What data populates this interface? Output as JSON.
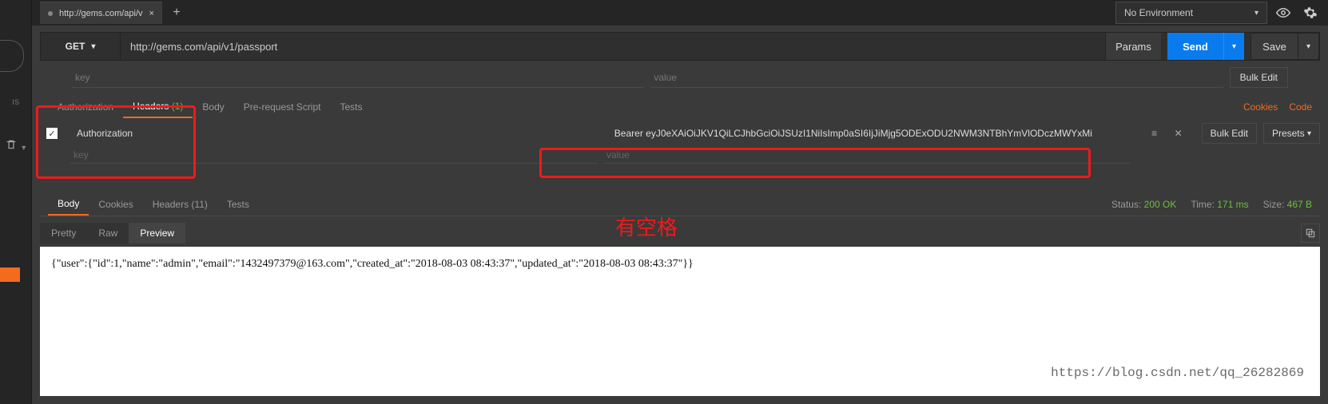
{
  "sidebar": {
    "label": "ıs",
    "trash_icon": "trash-icon"
  },
  "tab": {
    "title": "http://gems.com/api/v",
    "close": "×"
  },
  "env": {
    "selected": "No Environment",
    "eye": "eye-icon",
    "gear": "gear-icon"
  },
  "request": {
    "method": "GET",
    "url": "http://gems.com/api/v1/passport",
    "params_label": "Params",
    "send_label": "Send",
    "save_label": "Save"
  },
  "kv": {
    "key_placeholder": "key",
    "value_placeholder": "value",
    "bulk_edit": "Bulk Edit"
  },
  "tabs_req": {
    "authorization": "Authorization",
    "headers": "Headers",
    "headers_count": "(1)",
    "body": "Body",
    "prerequest": "Pre-request Script",
    "tests": "Tests",
    "cookies": "Cookies",
    "code": "Code"
  },
  "headers_row": {
    "checked": true,
    "key": "Authorization",
    "value": "Bearer eyJ0eXAiOiJKV1QiLCJhbGciOiJSUzI1NiIsImp0aSI6IjJiMjg5ODExODU2NWM3NTBhYmVlODczMWYxMi",
    "bulk_edit": "Bulk Edit",
    "presets": "Presets"
  },
  "ghost": {
    "key": "key",
    "value": "value"
  },
  "annotation": "有空格",
  "tabs_resp": {
    "body": "Body",
    "cookies": "Cookies",
    "headers": "Headers",
    "headers_count": "(11)",
    "tests": "Tests",
    "status_label": "Status:",
    "status_value": "200 OK",
    "time_label": "Time:",
    "time_value": "171 ms",
    "size_label": "Size:",
    "size_value": "467 B"
  },
  "view": {
    "pretty": "Pretty",
    "raw": "Raw",
    "preview": "Preview"
  },
  "response_body": "{\"user\":{\"id\":1,\"name\":\"admin\",\"email\":\"1432497379@163.com\",\"created_at\":\"2018-08-03 08:43:37\",\"updated_at\":\"2018-08-03 08:43:37\"}}",
  "watermark": "https://blog.csdn.net/qq_26282869"
}
